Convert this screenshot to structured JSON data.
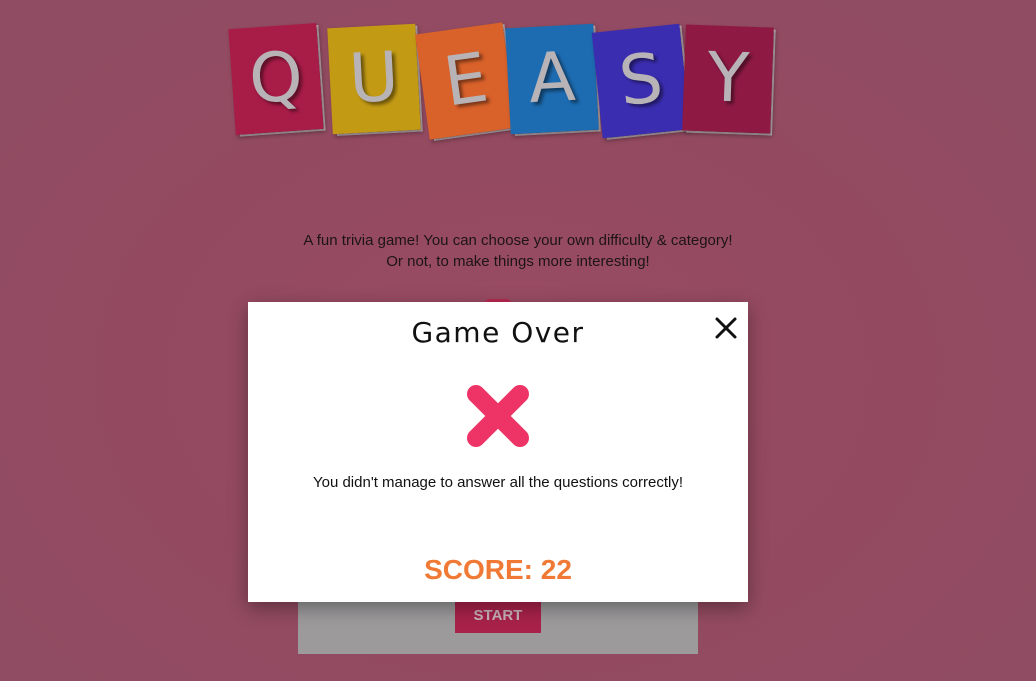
{
  "app": {
    "logo_letters": [
      "Q",
      "U",
      "E",
      "A",
      "S",
      "Y"
    ],
    "logo_colors": [
      "#a81c48",
      "#c39a14",
      "#d9612a",
      "#1d6bb0",
      "#3b2db0",
      "#8e1a44"
    ]
  },
  "intro": {
    "line1": "A fun trivia game! You can choose your own difficulty & category!",
    "line2": "Or not, to make things more interesting!"
  },
  "start_button": {
    "label": "START"
  },
  "modal": {
    "title": "Game Over",
    "close_icon": "close-icon",
    "status_icon": "fail-x-icon",
    "status_color": "#ee3366",
    "message": "You didn't manage to answer all the questions correctly!",
    "score_label": "SCORE:",
    "score_value": "22",
    "score_text": "SCORE: 22",
    "score_color": "#f07a35"
  }
}
